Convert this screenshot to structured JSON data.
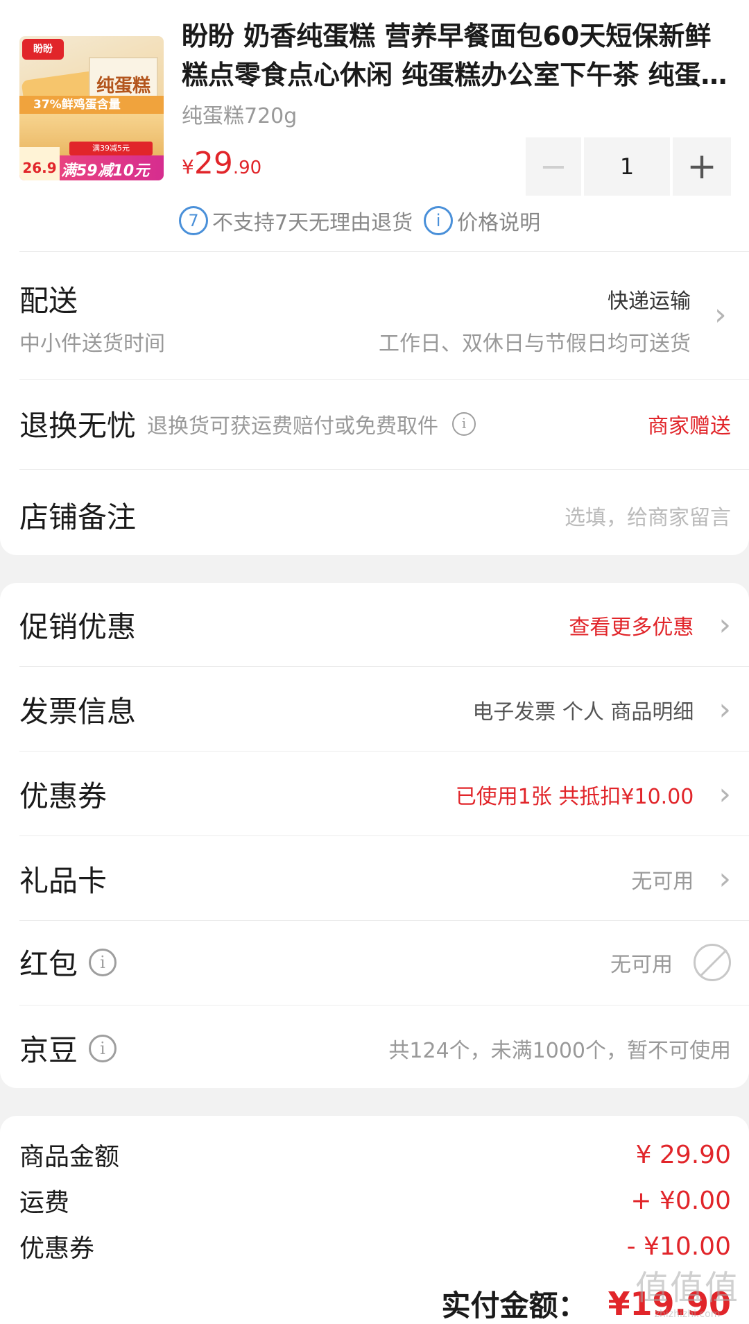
{
  "product": {
    "image": {
      "logo_text": "盼盼",
      "box_text": "纯蛋糕",
      "band_text": "37%鲜鸡蛋含量",
      "badge_price": "26.9",
      "promo_text": "满59减10元",
      "promo_sub": "满39减5元"
    },
    "title": "盼盼 奶香纯蛋糕 营养早餐面包60天短保新鲜糕点零食点心休闲 纯蛋糕办公室下午茶 纯蛋糕720g",
    "spec": "纯蛋糕720g",
    "price": {
      "currency": "¥",
      "integer": "29",
      "decimal": ".90"
    },
    "quantity": "1",
    "minus_label": "−",
    "plus_label": "+",
    "notes": {
      "no_return": "不支持7天无理由退货",
      "price_info": "价格说明"
    }
  },
  "delivery": {
    "label": "配送",
    "method": "快递运输",
    "sub_label": "中小件送货时间",
    "time": "工作日、双休日与节假日均可送货"
  },
  "return_service": {
    "label": "退换无忧",
    "desc": "退换货可获运费赔付或免费取件",
    "value": "商家赠送"
  },
  "shop_note": {
    "label": "店铺备注",
    "placeholder": "选填，给商家留言"
  },
  "options": {
    "promotion": {
      "label": "促销优惠",
      "value": "查看更多优惠"
    },
    "invoice": {
      "label": "发票信息",
      "value": "电子发票 个人 商品明细"
    },
    "coupon": {
      "label": "优惠券",
      "value": "已使用1张 共抵扣¥10.00"
    },
    "gift_card": {
      "label": "礼品卡",
      "value": "无可用"
    },
    "red_packet": {
      "label": "红包",
      "value": "无可用"
    },
    "jingdou": {
      "label": "京豆",
      "value": "共124个，未满1000个，暂不可使用"
    }
  },
  "summary": {
    "goods_label": "商品金额",
    "goods_value": "¥ 29.90",
    "shipping_label": "运费",
    "shipping_value": "+ ¥0.00",
    "coupon_label": "优惠券",
    "coupon_value": "- ¥10.00",
    "total_label": "实付金额：",
    "total_value": "¥19.90"
  },
  "watermark": {
    "text": "值值值",
    "url": "zhizhizhi.com"
  },
  "colors": {
    "accent": "#e1252a",
    "info_blue": "#4a90d9",
    "background": "#f2f2f2"
  }
}
